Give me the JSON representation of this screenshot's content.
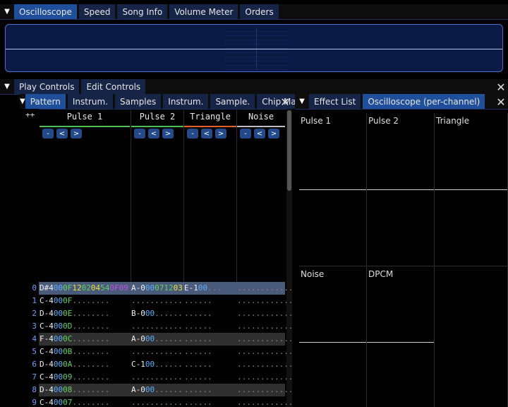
{
  "top_tabs": [
    {
      "label": "Oscilloscope",
      "active": true
    },
    {
      "label": "Speed"
    },
    {
      "label": "Song Info"
    },
    {
      "label": "Volume Meter"
    },
    {
      "label": "Orders"
    }
  ],
  "control_tabs": [
    {
      "label": "Play Controls"
    },
    {
      "label": "Edit Controls"
    }
  ],
  "pattern_tabs": [
    {
      "label": "Pattern",
      "active": true
    },
    {
      "label": "Instrum."
    },
    {
      "label": "Samples"
    },
    {
      "label": "Instrum."
    },
    {
      "label": "Sample."
    },
    {
      "label": "Chip Ma."
    }
  ],
  "right_tabs": [
    {
      "label": "Effect List"
    },
    {
      "label": "Oscilloscope (per-channel)",
      "active": true
    }
  ],
  "expand_label": "++",
  "channels": [
    {
      "name": "Pulse 1",
      "color": "#50c050"
    },
    {
      "name": "Pulse 2",
      "color": "#50c050"
    },
    {
      "name": "Triangle",
      "color": "#e06030"
    },
    {
      "name": "Noise",
      "color": "#c0c0c0"
    }
  ],
  "channel_buttons": [
    "-",
    "<",
    ">"
  ],
  "rows": [
    {
      "num": "0",
      "c1": [
        [
          "n",
          "D#4"
        ],
        [
          "ins",
          "00"
        ],
        [
          "vol",
          "0F"
        ],
        [
          "fx",
          "12"
        ],
        [
          "vol",
          "02"
        ],
        [
          "fx",
          "04"
        ],
        [
          "vol",
          "54"
        ],
        [
          "fxv",
          "0F09"
        ]
      ],
      "c2": [
        [
          "n",
          "A-0"
        ],
        [
          "ins",
          "00"
        ],
        [
          "vol",
          "07"
        ],
        [
          "vol",
          "12"
        ],
        [
          "fx",
          "03"
        ]
      ],
      "c3": [
        [
          "n",
          "E-1"
        ],
        [
          "ins",
          "00"
        ],
        [
          "dot",
          "..."
        ]
      ],
      "c4": [
        [
          "dot",
          "............"
        ]
      ]
    },
    {
      "num": "1",
      "c1": [
        [
          "n",
          "C-4"
        ],
        [
          "ins",
          "00"
        ],
        [
          "vol",
          "0F"
        ],
        [
          "dot",
          "........"
        ]
      ],
      "c2": [
        [
          "dot",
          "..........."
        ]
      ],
      "c3": [
        [
          "dot",
          "......"
        ]
      ],
      "c4": [
        [
          "dot",
          "............"
        ]
      ]
    },
    {
      "num": "2",
      "c1": [
        [
          "n",
          "D-4"
        ],
        [
          "ins",
          "00"
        ],
        [
          "vol",
          "0E"
        ],
        [
          "dot",
          "........"
        ]
      ],
      "c2": [
        [
          "n",
          "B-0"
        ],
        [
          "ins",
          "00"
        ],
        [
          "dot",
          "......"
        ]
      ],
      "c3": [
        [
          "dot",
          "......"
        ]
      ],
      "c4": [
        [
          "dot",
          "............"
        ]
      ]
    },
    {
      "num": "3",
      "c1": [
        [
          "n",
          "C-4"
        ],
        [
          "ins",
          "00"
        ],
        [
          "vol",
          "0D"
        ],
        [
          "dot",
          "........"
        ]
      ],
      "c2": [
        [
          "dot",
          "..........."
        ]
      ],
      "c3": [
        [
          "dot",
          "......"
        ]
      ],
      "c4": [
        [
          "dot",
          "............"
        ]
      ]
    },
    {
      "num": "4",
      "c1": [
        [
          "n",
          "F-4"
        ],
        [
          "ins",
          "00"
        ],
        [
          "vol",
          "0C"
        ],
        [
          "dot",
          "........"
        ]
      ],
      "c2": [
        [
          "n",
          "A-0"
        ],
        [
          "ins",
          "00"
        ],
        [
          "dot",
          "......"
        ]
      ],
      "c3": [
        [
          "dot",
          "......"
        ]
      ],
      "c4": [
        [
          "dot",
          "............"
        ]
      ]
    },
    {
      "num": "5",
      "c1": [
        [
          "n",
          "C-4"
        ],
        [
          "ins",
          "00"
        ],
        [
          "vol",
          "0B"
        ],
        [
          "dot",
          "........"
        ]
      ],
      "c2": [
        [
          "dot",
          "..........."
        ]
      ],
      "c3": [
        [
          "dot",
          "......"
        ]
      ],
      "c4": [
        [
          "dot",
          "............"
        ]
      ]
    },
    {
      "num": "6",
      "c1": [
        [
          "n",
          "D-4"
        ],
        [
          "ins",
          "00"
        ],
        [
          "vol",
          "0A"
        ],
        [
          "dot",
          "........"
        ]
      ],
      "c2": [
        [
          "n",
          "C-1"
        ],
        [
          "ins",
          "00"
        ],
        [
          "dot",
          "......"
        ]
      ],
      "c3": [
        [
          "dot",
          "......"
        ]
      ],
      "c4": [
        [
          "dot",
          "............"
        ]
      ]
    },
    {
      "num": "7",
      "c1": [
        [
          "n",
          "C-4"
        ],
        [
          "ins",
          "00"
        ],
        [
          "vol",
          "09"
        ],
        [
          "dot",
          "........"
        ]
      ],
      "c2": [
        [
          "dot",
          "..........."
        ]
      ],
      "c3": [
        [
          "dot",
          "......"
        ]
      ],
      "c4": [
        [
          "dot",
          "............"
        ]
      ]
    },
    {
      "num": "8",
      "c1": [
        [
          "n",
          "D-4"
        ],
        [
          "ins",
          "00"
        ],
        [
          "vol",
          "08"
        ],
        [
          "dot",
          "........"
        ]
      ],
      "c2": [
        [
          "n",
          "A-0"
        ],
        [
          "ins",
          "00"
        ],
        [
          "dot",
          "......"
        ]
      ],
      "c3": [
        [
          "dot",
          "......"
        ]
      ],
      "c4": [
        [
          "dot",
          "............"
        ]
      ]
    },
    {
      "num": "9",
      "c1": [
        [
          "n",
          "C-4"
        ],
        [
          "ins",
          "00"
        ],
        [
          "vol",
          "07"
        ],
        [
          "dot",
          "........"
        ]
      ],
      "c2": [
        [
          "dot",
          "..........."
        ]
      ],
      "c3": [
        [
          "dot",
          "......"
        ]
      ],
      "c4": [
        [
          "dot",
          "............"
        ]
      ]
    }
  ],
  "osc_channels": [
    "Pulse 1",
    "Pulse 2",
    "Triangle",
    "Noise",
    "DPCM",
    ""
  ],
  "icons": {
    "menu": "menu-triangle-icon",
    "close": "close-icon"
  }
}
